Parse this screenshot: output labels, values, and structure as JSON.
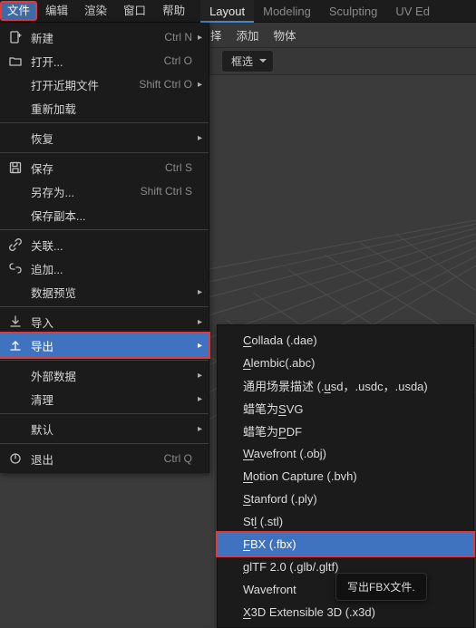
{
  "topbar": {
    "menus": [
      "文件",
      "编辑",
      "渲染",
      "窗口",
      "帮助"
    ],
    "active_index": 0,
    "workspaces": [
      "Layout",
      "Modeling",
      "Sculpting",
      "UV Ed"
    ],
    "workspace_active_index": 0
  },
  "secondbar": {
    "items": [
      "择",
      "添加",
      "物体"
    ]
  },
  "thirdbar": {
    "select_mode": "框选"
  },
  "file_menu": {
    "groups": [
      [
        {
          "icon": "file-new-icon",
          "label": "新建",
          "shortcut": "Ctrl N",
          "sub": true
        },
        {
          "icon": "folder-open-icon",
          "label": "打开...",
          "shortcut": "Ctrl O",
          "sub": false
        },
        {
          "icon": "",
          "label": "打开近期文件",
          "shortcut": "Shift Ctrl O",
          "sub": true
        },
        {
          "icon": "",
          "label": "重新加载",
          "shortcut": "",
          "sub": false
        }
      ],
      [
        {
          "icon": "",
          "label": "恢复",
          "shortcut": "",
          "sub": true
        }
      ],
      [
        {
          "icon": "save-icon",
          "label": "保存",
          "shortcut": "Ctrl S",
          "sub": false
        },
        {
          "icon": "",
          "label": "另存为...",
          "shortcut": "Shift Ctrl S",
          "sub": false
        },
        {
          "icon": "",
          "label": "保存副本...",
          "shortcut": "",
          "sub": false
        }
      ],
      [
        {
          "icon": "link-icon",
          "label": "关联...",
          "shortcut": "",
          "sub": false
        },
        {
          "icon": "append-icon",
          "label": "追加...",
          "shortcut": "",
          "sub": false
        },
        {
          "icon": "",
          "label": "数据预览",
          "shortcut": "",
          "sub": true
        }
      ],
      [
        {
          "icon": "import-icon",
          "label": "导入",
          "shortcut": "",
          "sub": true
        },
        {
          "icon": "export-icon",
          "label": "导出",
          "shortcut": "",
          "sub": true,
          "highlight": true
        }
      ],
      [
        {
          "icon": "",
          "label": "外部数据",
          "shortcut": "",
          "sub": true
        },
        {
          "icon": "",
          "label": "清理",
          "shortcut": "",
          "sub": true
        }
      ],
      [
        {
          "icon": "",
          "label": "默认",
          "shortcut": "",
          "sub": true
        }
      ],
      [
        {
          "icon": "quit-icon",
          "label": "退出",
          "shortcut": "Ctrl Q",
          "sub": false
        }
      ]
    ]
  },
  "export_submenu": {
    "items": [
      {
        "pre": "",
        "ul": "C",
        "post": "ollada (.dae)"
      },
      {
        "pre": "",
        "ul": "A",
        "post": "lembic(.abc)"
      },
      {
        "pre": "通用场景描述 (.",
        "ul": "u",
        "post": "sd，.usdc，.usda)"
      },
      {
        "pre": "蜡笔为",
        "ul": "S",
        "post": "VG"
      },
      {
        "pre": "蜡笔为",
        "ul": "P",
        "post": "DF"
      },
      {
        "pre": "",
        "ul": "W",
        "post": "avefront (.obj)"
      },
      {
        "pre": "",
        "ul": "M",
        "post": "otion Capture (.bvh)"
      },
      {
        "pre": "",
        "ul": "S",
        "post": "tanford (.ply)"
      },
      {
        "pre": "St",
        "ul": "l",
        "post": " (.stl)"
      },
      {
        "pre": "",
        "ul": "F",
        "post": "BX (.fbx)",
        "highlight": true
      },
      {
        "pre": "",
        "ul": "g",
        "post": "lTF 2.0 (.glb/.gltf)"
      },
      {
        "pre": "Wavefront",
        "ul": "",
        "post": ""
      },
      {
        "pre": "",
        "ul": "X",
        "post": "3D Extensible 3D (.x3d)"
      }
    ]
  },
  "tooltip": {
    "text": "写出FBX文件."
  }
}
